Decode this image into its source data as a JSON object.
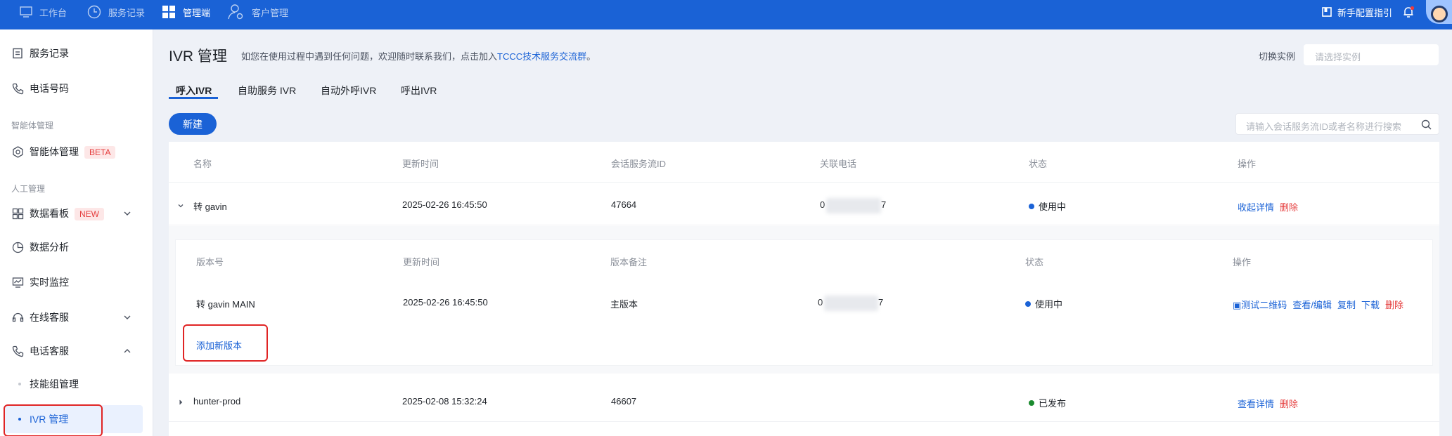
{
  "topbar": {
    "nav": [
      {
        "label": "工作台",
        "icon": "monitor-icon"
      },
      {
        "label": "服务记录",
        "icon": "clock-icon"
      },
      {
        "label": "管理端",
        "icon": "grid-icon",
        "active": true
      },
      {
        "label": "客户管理",
        "icon": "user-settings-icon"
      }
    ],
    "guide_label": "新手配置指引",
    "colors": {
      "bar": "#1a62d6"
    }
  },
  "sidebar": {
    "items_top": [
      {
        "label": "服务记录",
        "icon": "document-icon"
      },
      {
        "label": "电话号码",
        "icon": "phone-icon"
      }
    ],
    "group_ai": "智能体管理",
    "ai_item": {
      "label": "智能体管理",
      "badge": "BETA",
      "icon": "gear-hex-icon"
    },
    "group_manual": "人工管理",
    "items_manual": [
      {
        "label": "数据看板",
        "badge": "NEW",
        "icon": "dashboard-icon",
        "chevron": "down"
      },
      {
        "label": "数据分析",
        "icon": "pie-icon"
      },
      {
        "label": "实时监控",
        "icon": "monitor-chart-icon"
      },
      {
        "label": "在线客服",
        "icon": "headset-icon",
        "chevron": "down"
      },
      {
        "label": "电话客服",
        "icon": "phone-icon",
        "chevron": "up"
      }
    ],
    "sub_items": [
      {
        "label": "技能组管理"
      },
      {
        "label": "IVR 管理",
        "active": true
      }
    ]
  },
  "page": {
    "title": "IVR 管理",
    "notice_prefix": "如您在使用过程中遇到任何问题，欢迎随时联系我们，点击加入",
    "notice_link": "TCCC技术服务交流群",
    "notice_suffix": "。",
    "switch_label": "切换实例",
    "instance_placeholder": "请选择实例",
    "tabs": [
      "呼入IVR",
      "自助服务 IVR",
      "自动外呼IVR",
      "呼出IVR"
    ],
    "new_button": "新建",
    "search_placeholder": "请输入会话服务流ID或者名称进行搜索"
  },
  "table": {
    "headers": [
      "名称",
      "更新时间",
      "会话服务流ID",
      "关联电话",
      "状态",
      "操作"
    ],
    "rows": [
      {
        "name": "转 gavin",
        "updated": "2025-02-26 16:45:50",
        "flow_id": "47664",
        "phone_prefix": "0",
        "phone_suffix": "7",
        "status": "使用中",
        "status_color": "#1a62d6",
        "ops": [
          "收起详情",
          "删除"
        ]
      },
      {
        "name": "hunter-prod",
        "updated": "2025-02-08 15:32:24",
        "flow_id": "46607",
        "status": "已发布",
        "status_color": "#1a8a2e",
        "ops": [
          "查看详情",
          "删除"
        ]
      }
    ],
    "version_headers": [
      "版本号",
      "更新时间",
      "版本备注",
      "状态",
      "操作"
    ],
    "version_row": {
      "name": "转 gavin MAIN",
      "updated": "2025-02-26 16:45:50",
      "note": "主版本",
      "phone_prefix": "0",
      "phone_suffix": "7",
      "status": "使用中",
      "ops": [
        "测试二维码",
        "查看/编辑",
        "复制",
        "下载",
        "删除"
      ]
    },
    "add_version": "添加新版本"
  }
}
